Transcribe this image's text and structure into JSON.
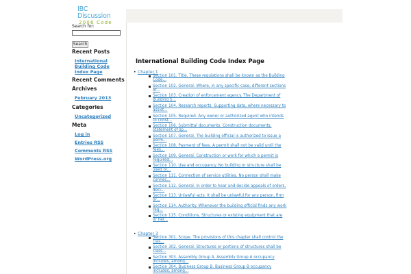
{
  "site": {
    "title_line1": "IBC",
    "title_line2": "Discussion",
    "tagline": "2006 Code"
  },
  "sidebar": {
    "search_label": "Search for:",
    "search_value": "",
    "search_button": "Search",
    "recent_posts_heading": "Recent Posts",
    "recent_posts": [
      "International Building Code Index Page"
    ],
    "recent_comments_heading": "Recent Comments",
    "archives_heading": "Archives",
    "archives": [
      "February 2013"
    ],
    "categories_heading": "Categories",
    "categories": [
      "Uncategorized"
    ],
    "meta_heading": "Meta",
    "meta_links": [
      "Log in",
      "Entries RSS",
      "Comments RSS",
      "WordPress.org"
    ]
  },
  "main": {
    "page_title": "International Building Code Index Page",
    "chapters": [
      {
        "label": "Chapter 1",
        "sections": [
          "Section 101. Title. These regulations shall be known as the Building Code...",
          "Section 102. General. Where, in any specific case, different sections of...",
          "Section 103. Creation of enforcement agency. The Department of Building S...",
          "Section 104. Research reports. Supporting data, where necessary to assist...",
          "Section 105. Required. Any owner or authorized agent who intends to const...",
          "Section 106. Submittal documents. Construction documents, statement of sp...",
          "Section 107. General. The building official is authorized to issue a perm...",
          "Section 108. Payment of fees. A permit shall not be valid until the fees...",
          "Section 109. General. Construction or work for which a permit is required...",
          "Section 110. Use and occupancy. No building or structure shall be used or...",
          "Section 111. Connection of service utilities. No person shall make connec...",
          "Section 112. General. In order to hear and decide appeals of orders, deci...",
          "Section 113. Unlawful acts. It shall be unlawful for any person, firm or...",
          "Section 114. Authority. Whenever the building official finds any work reg...",
          "Section 115. Conditions. Structures or existing equipment that are or her..."
        ]
      },
      {
        "label": "Chapter 3",
        "sections": [
          "Section 301. Scope. The provisions of this chapter shall control the clas...",
          "Section 302. General. Structures or portions of structures shall be class...",
          "Section 303. Assembly Group A. Assembly Group A occupancy includes, among...",
          "Section 304. Business Group B. Business Group B occupancy includes, among..."
        ]
      }
    ]
  }
}
